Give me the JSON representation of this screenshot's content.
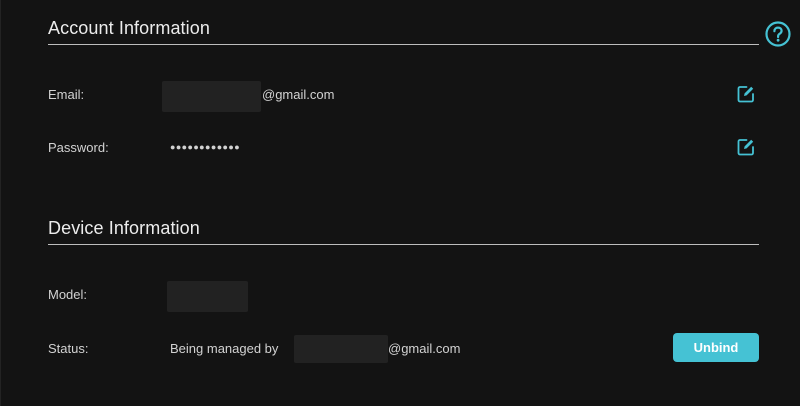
{
  "account": {
    "title": "Account Information",
    "email_label": "Email:",
    "email_suffix": "@gmail.com",
    "password_label": "Password:",
    "password_mask": "●●●●●●●●●●●●"
  },
  "device": {
    "title": "Device Information",
    "model_label": "Model:",
    "status_label": "Status:",
    "status_prefix": "Being managed by",
    "status_suffix": "@gmail.com",
    "unbind_label": "Unbind"
  },
  "icons": {
    "help": "help-circle-icon",
    "edit": "edit-icon"
  },
  "colors": {
    "background": "#131313",
    "accent": "#45c2d4",
    "text": "#d2d2d2",
    "rule": "#bdbdbd"
  }
}
